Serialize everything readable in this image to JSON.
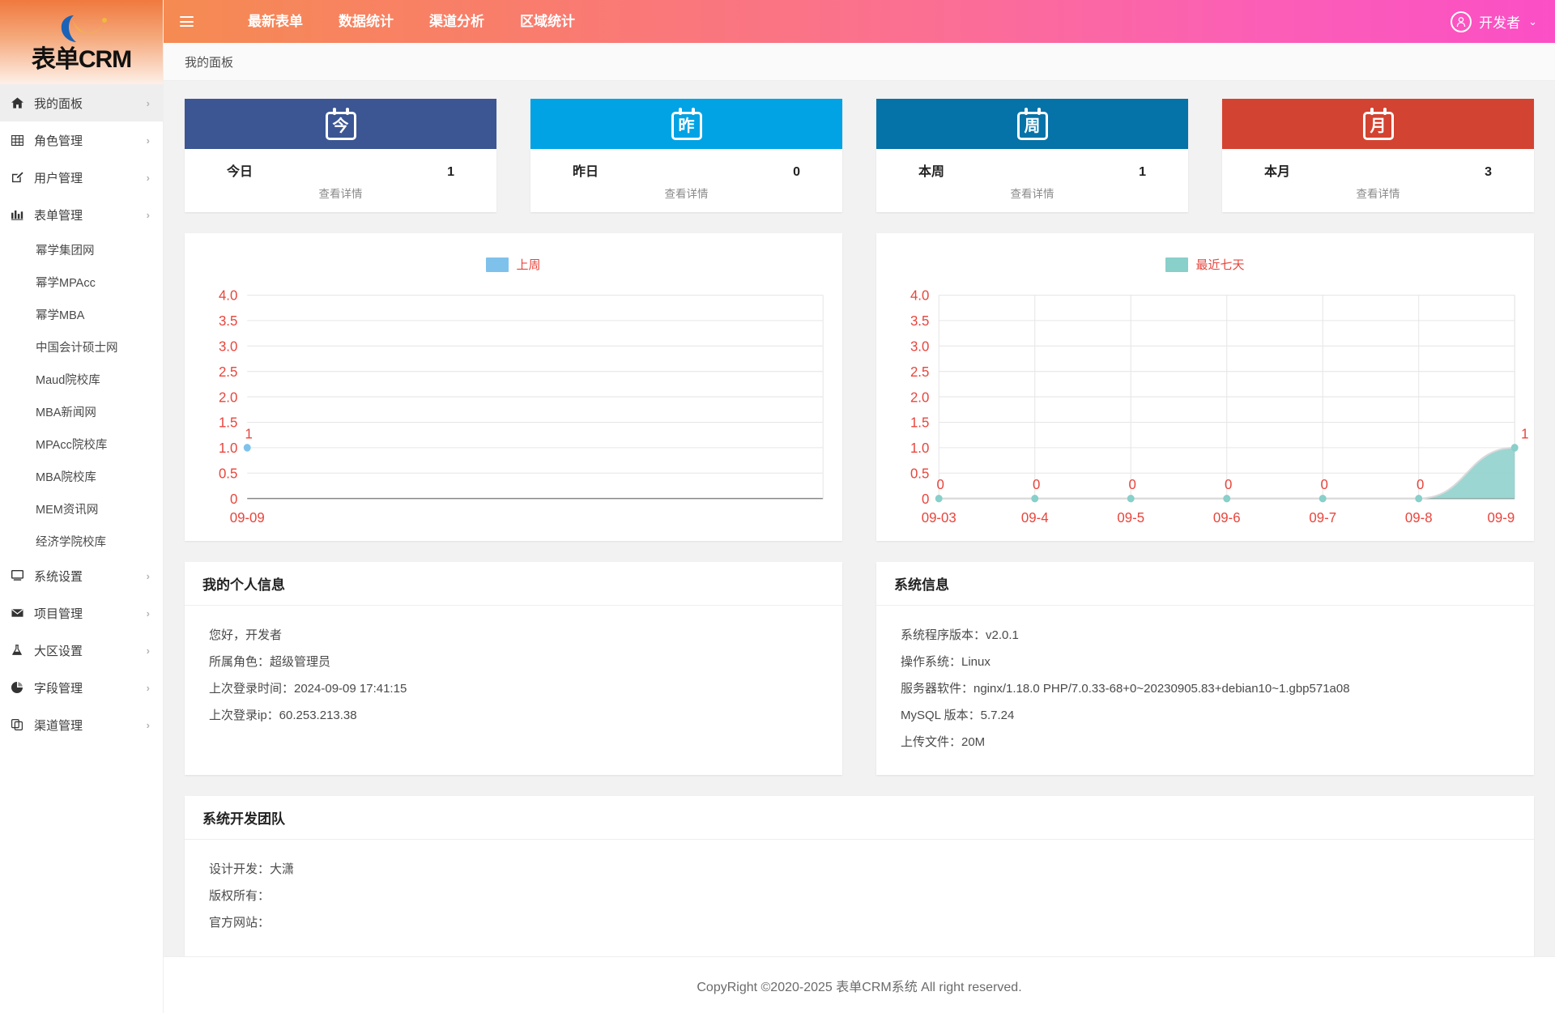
{
  "brand": {
    "name": "表单CRM",
    "logo_icon": "swoosh-crescent-logo"
  },
  "header": {
    "menu_icon": "hamburger-icon",
    "nav": [
      {
        "label": "最新表单"
      },
      {
        "label": "数据统计"
      },
      {
        "label": "渠道分析"
      },
      {
        "label": "区域统计"
      }
    ],
    "user": {
      "name": "开发者",
      "avatar_icon": "user-circle-icon",
      "caret_icon": "chevron-down-icon"
    }
  },
  "breadcrumb": {
    "current": "我的面板"
  },
  "sidebar": {
    "items": [
      {
        "label": "我的面板",
        "icon": "home-icon",
        "active": true,
        "arrow": "›"
      },
      {
        "label": "角色管理",
        "icon": "grid-icon",
        "active": false,
        "arrow": "›"
      },
      {
        "label": "用户管理",
        "icon": "edit-square-icon",
        "active": false,
        "arrow": "›"
      },
      {
        "label": "表单管理",
        "icon": "bar-chart-icon",
        "active": false,
        "arrow": "›"
      }
    ],
    "form_children": [
      {
        "label": "幂学集团网"
      },
      {
        "label": "幂学MPAcc"
      },
      {
        "label": "幂学MBA"
      },
      {
        "label": "中国会计硕士网"
      },
      {
        "label": "Maud院校库"
      },
      {
        "label": "MBA新闻网"
      },
      {
        "label": "MPAcc院校库"
      },
      {
        "label": "MBA院校库"
      },
      {
        "label": "MEM资讯网"
      },
      {
        "label": "经济学院校库"
      }
    ],
    "items_bottom": [
      {
        "label": "系统设置",
        "icon": "monitor-icon",
        "arrow": "›"
      },
      {
        "label": "项目管理",
        "icon": "envelope-icon",
        "arrow": "›"
      },
      {
        "label": "大区设置",
        "icon": "flask-icon",
        "arrow": "›"
      },
      {
        "label": "字段管理",
        "icon": "pie-chart-icon",
        "arrow": "›"
      },
      {
        "label": "渠道管理",
        "icon": "copy-icon",
        "arrow": "›"
      }
    ]
  },
  "stats": [
    {
      "glyph": "今",
      "label": "今日",
      "value": "1",
      "more": "查看详情",
      "color": "#3b5693"
    },
    {
      "glyph": "昨",
      "label": "昨日",
      "value": "0",
      "more": "查看详情",
      "color": "#01a3e4"
    },
    {
      "glyph": "周",
      "label": "本周",
      "value": "1",
      "more": "查看详情",
      "color": "#0573a8"
    },
    {
      "glyph": "月",
      "label": "本月",
      "value": "3",
      "more": "查看详情",
      "color": "#d34331"
    }
  ],
  "chart_data": [
    {
      "type": "area",
      "title": "",
      "legend": "上周",
      "legend_position": "top-center",
      "color": "#7ec2ec",
      "categories": [
        "09-09"
      ],
      "values": [
        1
      ],
      "point_labels": [
        "1"
      ],
      "xlabel": "",
      "ylabel": "",
      "ylim": [
        0,
        4
      ],
      "yticks": [
        "0",
        "0.5",
        "1.0",
        "1.5",
        "2.0",
        "2.5",
        "3.0",
        "3.5",
        "4.0"
      ],
      "grid": true,
      "axis_label_color": "#e8453c"
    },
    {
      "type": "area",
      "title": "",
      "legend": "最近七天",
      "legend_position": "top-center",
      "color": "#89cfca",
      "categories": [
        "09-03",
        "09-4",
        "09-5",
        "09-6",
        "09-7",
        "09-8",
        "09-9"
      ],
      "values": [
        0,
        0,
        0,
        0,
        0,
        0,
        1
      ],
      "point_labels": [
        "0",
        "0",
        "0",
        "0",
        "0",
        "0",
        "1"
      ],
      "xlabel": "",
      "ylabel": "",
      "ylim": [
        0,
        4
      ],
      "yticks": [
        "0",
        "0.5",
        "1.0",
        "1.5",
        "2.0",
        "2.5",
        "3.0",
        "3.5",
        "4.0"
      ],
      "grid": true,
      "axis_label_color": "#e8453c"
    }
  ],
  "personal_info": {
    "title": "我的个人信息",
    "lines": [
      "您好，开发者",
      "所属角色：超级管理员",
      "上次登录时间：2024-09-09 17:41:15",
      "上次登录ip：60.253.213.38"
    ]
  },
  "system_info": {
    "title": "系统信息",
    "lines": [
      "系统程序版本：v2.0.1",
      "操作系统：Linux",
      "服务器软件：nginx/1.18.0  PHP/7.0.33-68+0~20230905.83+debian10~1.gbp571a08",
      "MySQL 版本：5.7.24",
      "上传文件：20M"
    ]
  },
  "dev_team": {
    "title": "系统开发团队",
    "lines": [
      "设计开发：大潇",
      "版权所有：",
      "官方网站："
    ]
  },
  "footer": {
    "text": "CopyRight ©2020-2025 表单CRM系统 All right reserved."
  }
}
